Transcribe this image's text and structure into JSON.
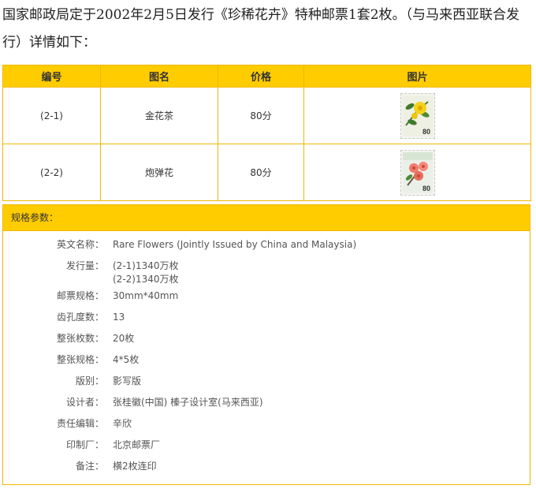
{
  "intro": "国家邮政局定于2002年2月5日发行《珍稀花卉》特种邮票1套2枚。（与马来西亚联合发行）详情如下：",
  "table": {
    "headers": [
      "编号",
      "图名",
      "价格",
      "图片"
    ],
    "rows": [
      {
        "code": "(2-1)",
        "name": "金花茶",
        "price": "80分",
        "stamp_value": "80",
        "image": "yellow-camellia-stamp"
      },
      {
        "code": "(2-2)",
        "name": "炮弹花",
        "price": "80分",
        "stamp_value": "80",
        "image": "cannonball-flower-stamp"
      }
    ]
  },
  "spec": {
    "title": "规格参数：",
    "rows": [
      {
        "label": "英文名称：",
        "value": "Rare Flowers (Jointly Issued by China and Malaysia)"
      },
      {
        "label": "发行量：",
        "value": "(2-1)1340万枚",
        "value2": "(2-2)1340万枚"
      },
      {
        "label": "邮票规格：",
        "value": "30mm*40mm"
      },
      {
        "label": "齿孔度数：",
        "value": "13"
      },
      {
        "label": "整张枚数：",
        "value": "20枚"
      },
      {
        "label": "整张规格：",
        "value": "4*5枚"
      },
      {
        "label": "版别：",
        "value": "影写版"
      },
      {
        "label": "设计者：",
        "value": "张桂徽(中国) 榛子设计室(马来西亚)"
      },
      {
        "label": "责任编辑：",
        "value": "辛欣"
      },
      {
        "label": "印制厂：",
        "value": "北京邮票厂"
      },
      {
        "label": "备注：",
        "value": "横2枚连印"
      }
    ]
  },
  "colors": {
    "header_bg": "#ffcc00",
    "border": "#f0b800"
  }
}
